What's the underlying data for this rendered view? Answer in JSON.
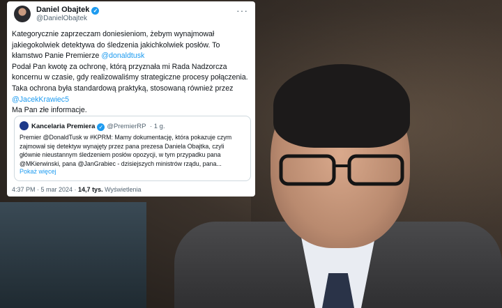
{
  "tweet": {
    "author_name": "Daniel Obajtek",
    "author_handle": "@DanielObajtek",
    "more": "···",
    "lines": {
      "p1a": "Kategorycznie zaprzeczam doniesieniom, żebym wynajmował jakiegokolwiek detektywa do śledzenia jakichkolwiek posłów. To kłamstwo Panie Premierze ",
      "p1_mention": "@donaldtusk",
      "p2a": "Podał Pan kwotę za ochronę, którą przyznała mi Rada Nadzorcza koncernu w czasie, gdy realizowaliśmy strategiczne procesy połączenia. Taka ochrona była standardową praktyką, stosowaną również przez ",
      "p2_mention": "@JacekKrawiec5",
      "p3": "Ma Pan złe informacje."
    },
    "quote": {
      "name": "Kancelaria Premiera",
      "handle": "@PremierRP",
      "time": "· 1 g.",
      "text": "Premier @DonaldTusk w #KPRM: Mamy dokumentację, która pokazuje czym zajmował się detektyw wynajęty przez pana prezesa Daniela Obajtka, czyli głównie nieustannym śledzeniem posłów opozycji, w tym przypadku pana @MKierwinski, pana @JanGrabiec - dzisiejszych ministrów rządu, pana...",
      "show_more": "Pokaż więcej"
    },
    "meta": {
      "time": "4:37 PM · 5 mar 2024 · ",
      "views": "14,7 tys.",
      "views_label": " Wyświetlenia"
    }
  },
  "colors": {
    "link": "#1d9bf0",
    "text": "#0f1419",
    "muted": "#536471"
  }
}
